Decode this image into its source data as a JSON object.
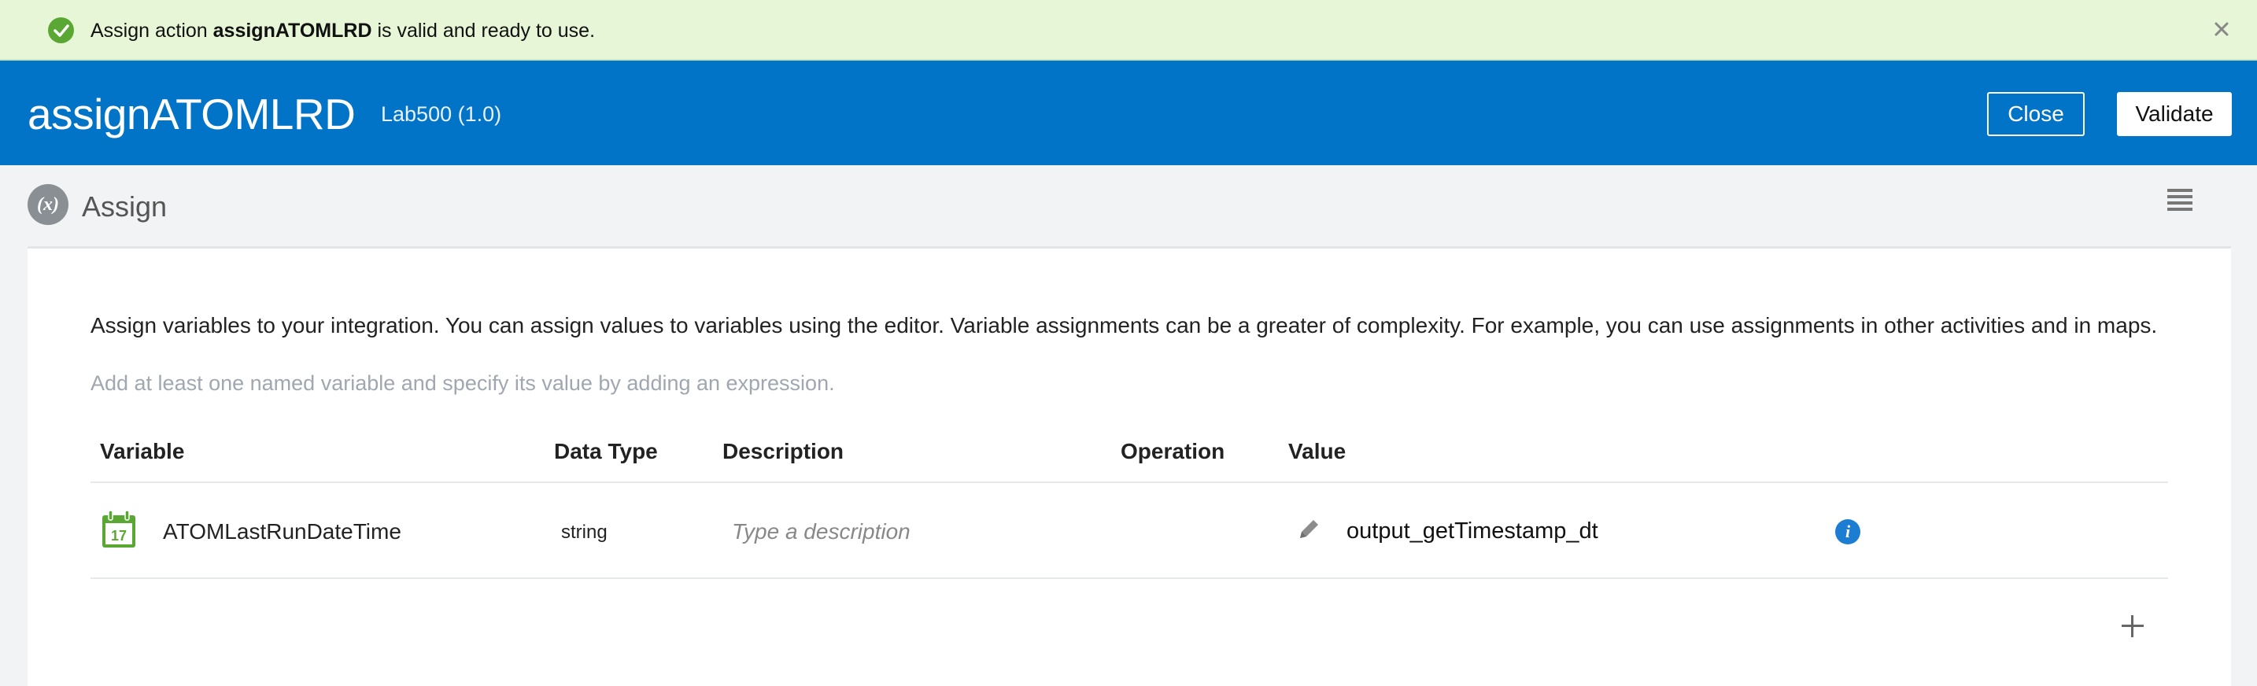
{
  "banner": {
    "prefix": "Assign action ",
    "name": "assignATOMLRD",
    "suffix": " is valid and ready to use.",
    "icon": "check-circle-icon",
    "close_icon": "close-icon",
    "color": "#e6f6d6"
  },
  "header": {
    "title": "assignATOMLRD",
    "subtitle": "Lab500 (1.0)",
    "close_label": "Close",
    "validate_label": "Validate",
    "color": "#0274c7"
  },
  "activity": {
    "icon_label": "(x)",
    "title": "Assign",
    "menu_icon": "hamburger-menu-icon"
  },
  "card": {
    "description": "Assign variables to your integration. You can assign values to variables using the editor. Variable assignments can be a greater of complexity. For example, you can use assignments in other activities and in maps.",
    "hint": "Add at least one named variable and specify its value by adding an expression."
  },
  "table": {
    "headers": {
      "variable": "Variable",
      "data_type": "Data Type",
      "description": "Description",
      "operation": "Operation",
      "value": "Value"
    },
    "rows": [
      {
        "icon": "calendar-icon",
        "calendar_day": "17",
        "variable": "ATOMLastRunDateTime",
        "data_type": "string",
        "description_placeholder": "Type a description",
        "description_value": "",
        "operation_icon": "pencil-icon",
        "value": "output_getTimestamp_dt",
        "info_icon": "info-icon"
      }
    ],
    "add_icon": "plus-icon"
  }
}
